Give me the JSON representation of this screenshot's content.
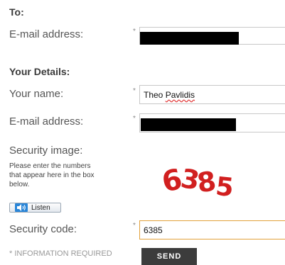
{
  "to_section": {
    "heading": "To:",
    "email_label": "E-mail address:",
    "email_value": ""
  },
  "details_section": {
    "heading": "Your Details:",
    "name_label": "Your name:",
    "name_value_first": "Theo",
    "name_value_last": "Pavlidis",
    "email_label": "E-mail address:",
    "email_value": ""
  },
  "security": {
    "label": "Security image:",
    "help_lines": [
      "Please enter the numbers",
      "that appear here in the box",
      "below."
    ],
    "captcha_digits": [
      "6",
      "3",
      "8",
      "5"
    ],
    "listen_label": "Listen",
    "code_label": "Security code:",
    "code_value": "6385"
  },
  "required_marker": "*",
  "required_note": "* INFORMATION REQUIRED",
  "send_label": "SEND",
  "colors": {
    "captcha": "#d11f1f",
    "focus_border": "#e2a13a",
    "send_bg": "#3c3c3c",
    "listen_icon": "#2a86d8"
  }
}
